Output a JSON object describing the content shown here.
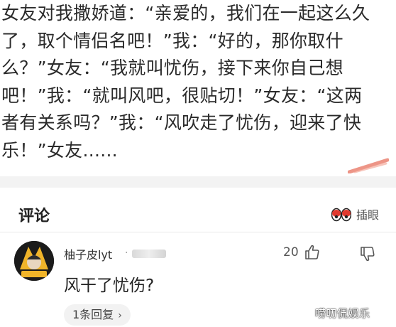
{
  "post": {
    "lines": [
      "女友对我撒娇道：“亲爱的，我们在一起这么久",
      "了，取个情侣名吧！”我：“好的，那你取什",
      "么？”女友：“我就叫忧伤，接下来你自己想",
      "吧！”我：“就叫风吧，很贴切！”女友：“这两",
      "者有关系吗？”我：“风吹走了忧伤，迎来了快",
      "乐！”女友......"
    ]
  },
  "comments": {
    "title": "评论",
    "insert_label": "插眼",
    "items": [
      {
        "user": "柚子皮lyt",
        "dot": "·",
        "likes": "20",
        "text": "风干了忧伤?",
        "reply_label": "1条回复",
        "reply_chevron": "›"
      }
    ]
  },
  "watermark": "唠叨侃娱乐",
  "colors": {
    "accent_red": "#e03a2f",
    "text_primary": "#222222",
    "divider": "#f3f3f3"
  }
}
